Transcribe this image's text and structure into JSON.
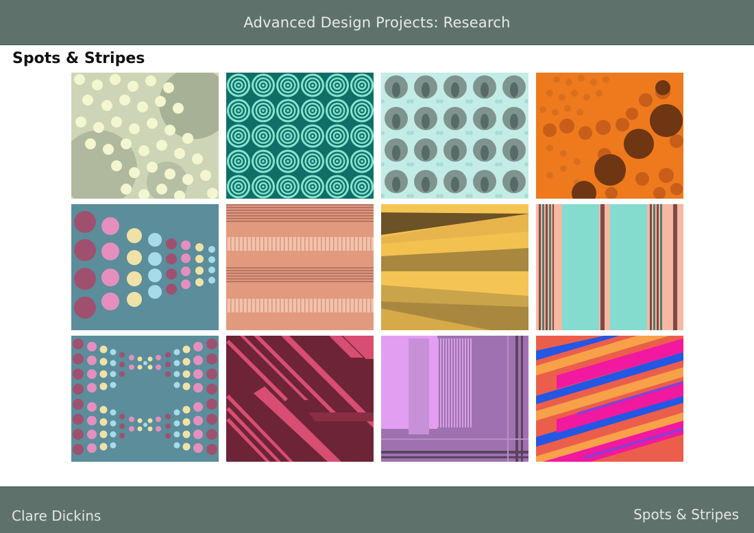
{
  "header": {
    "title": "Advanced Design Projects: Research"
  },
  "slide": {
    "title": "Spots & Stripes"
  },
  "footer": {
    "author": "Clare Dickins",
    "section": "Spots & Stripes"
  },
  "gallery": {
    "tiles": [
      {
        "name": "pattern-tile-sage-dots",
        "colors": [
          "#cdd5b6",
          "#9aa48a",
          "#f3f6cf"
        ]
      },
      {
        "name": "pattern-tile-teal-concentric",
        "colors": [
          "#0f6e68",
          "#86e6cf"
        ]
      },
      {
        "name": "pattern-tile-mint-ovals",
        "colors": [
          "#c3ece6",
          "#7f948f",
          "#566a66"
        ]
      },
      {
        "name": "pattern-tile-orange-dots",
        "colors": [
          "#ee7a1d",
          "#c85e1a",
          "#6e3612"
        ]
      },
      {
        "name": "pattern-tile-pink-gradient-dots",
        "colors": [
          "#5b8d9b",
          "#a0506f",
          "#e58fbf",
          "#f0e2a6",
          "#a6dcea"
        ]
      },
      {
        "name": "pattern-tile-salmon-stripes",
        "colors": [
          "#e19a7e",
          "#b67363",
          "#f2c3ab"
        ]
      },
      {
        "name": "pattern-tile-mustard-wedges",
        "colors": [
          "#f4c554",
          "#a8883e",
          "#6b5227"
        ]
      },
      {
        "name": "pattern-tile-mint-vertical-stripes",
        "colors": [
          "#84dcce",
          "#f6b8a3",
          "#7e4a45"
        ]
      },
      {
        "name": "pattern-tile-bowtie-dots",
        "colors": [
          "#5b8d9b",
          "#a0506f",
          "#e58fbf",
          "#f0e2a6",
          "#a6dcea"
        ]
      },
      {
        "name": "pattern-tile-burgundy-diagonals",
        "colors": [
          "#6d2436",
          "#d84e72"
        ]
      },
      {
        "name": "pattern-tile-lilac-plaid",
        "colors": [
          "#9f71b0",
          "#e29ff2",
          "#5b4360"
        ]
      },
      {
        "name": "pattern-tile-neon-diagonals",
        "colors": [
          "#eb5e4c",
          "#f2189f",
          "#2357e4",
          "#f7a148"
        ]
      }
    ]
  }
}
